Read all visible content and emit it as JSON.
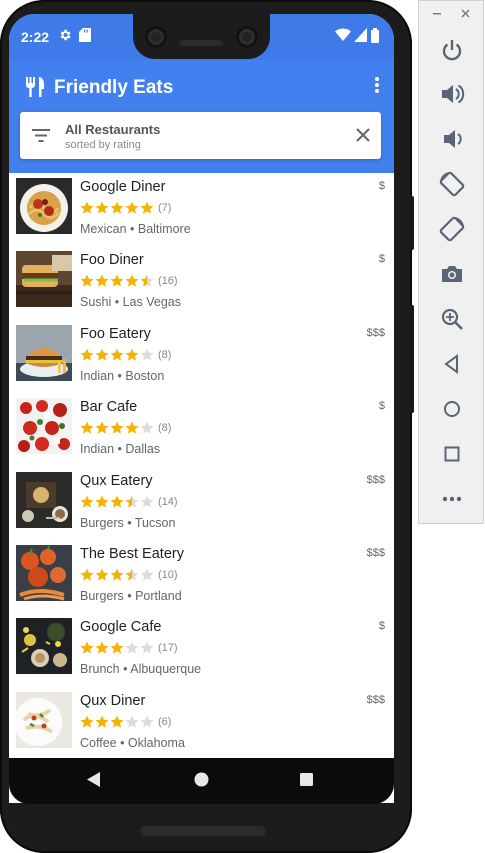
{
  "status_bar": {
    "time": "2:22"
  },
  "app_bar": {
    "title": "Friendly Eats"
  },
  "filter": {
    "title": "All Restaurants",
    "subtitle": "sorted by rating"
  },
  "restaurants": [
    {
      "name": "Google Diner",
      "rating": 5.0,
      "count": "(7)",
      "category": "Mexican",
      "city": "Baltimore",
      "meta": "Mexican • Baltimore",
      "price": "$"
    },
    {
      "name": "Foo Diner",
      "rating": 4.5,
      "count": "(16)",
      "category": "Sushi",
      "city": "Las Vegas",
      "meta": "Sushi • Las Vegas",
      "price": "$"
    },
    {
      "name": "Foo Eatery",
      "rating": 4.0,
      "count": "(8)",
      "category": "Indian",
      "city": "Boston",
      "meta": "Indian • Boston",
      "price": "$$$"
    },
    {
      "name": "Bar Cafe",
      "rating": 4.0,
      "count": "(8)",
      "category": "Indian",
      "city": "Dallas",
      "meta": "Indian • Dallas",
      "price": "$"
    },
    {
      "name": "Qux Eatery",
      "rating": 3.5,
      "count": "(14)",
      "category": "Burgers",
      "city": "Tucson",
      "meta": "Burgers • Tucson",
      "price": "$$$"
    },
    {
      "name": "The Best Eatery",
      "rating": 3.5,
      "count": "(10)",
      "category": "Burgers",
      "city": "Portland",
      "meta": "Burgers • Portland",
      "price": "$$$"
    },
    {
      "name": "Google Cafe",
      "rating": 3.0,
      "count": "(17)",
      "category": "Brunch",
      "city": "Albuquerque",
      "meta": "Brunch • Albuquerque",
      "price": "$"
    },
    {
      "name": "Qux Diner",
      "rating": 3.0,
      "count": "(6)",
      "category": "Coffee",
      "city": "Oklahoma",
      "meta": "Coffee • Oklahoma",
      "price": "$$$"
    }
  ],
  "emulator_toolbar": {
    "buttons": [
      "power-icon",
      "volume-up-icon",
      "volume-down-icon",
      "rotate-left-icon",
      "rotate-right-icon",
      "camera-icon",
      "zoom-icon",
      "back-icon",
      "home-icon",
      "overview-icon",
      "more-icon"
    ]
  },
  "colors": {
    "primary": "#4180ee",
    "status_bar": "#3e7be8",
    "star": "#f5b301",
    "star_empty": "#dcdcdc"
  }
}
